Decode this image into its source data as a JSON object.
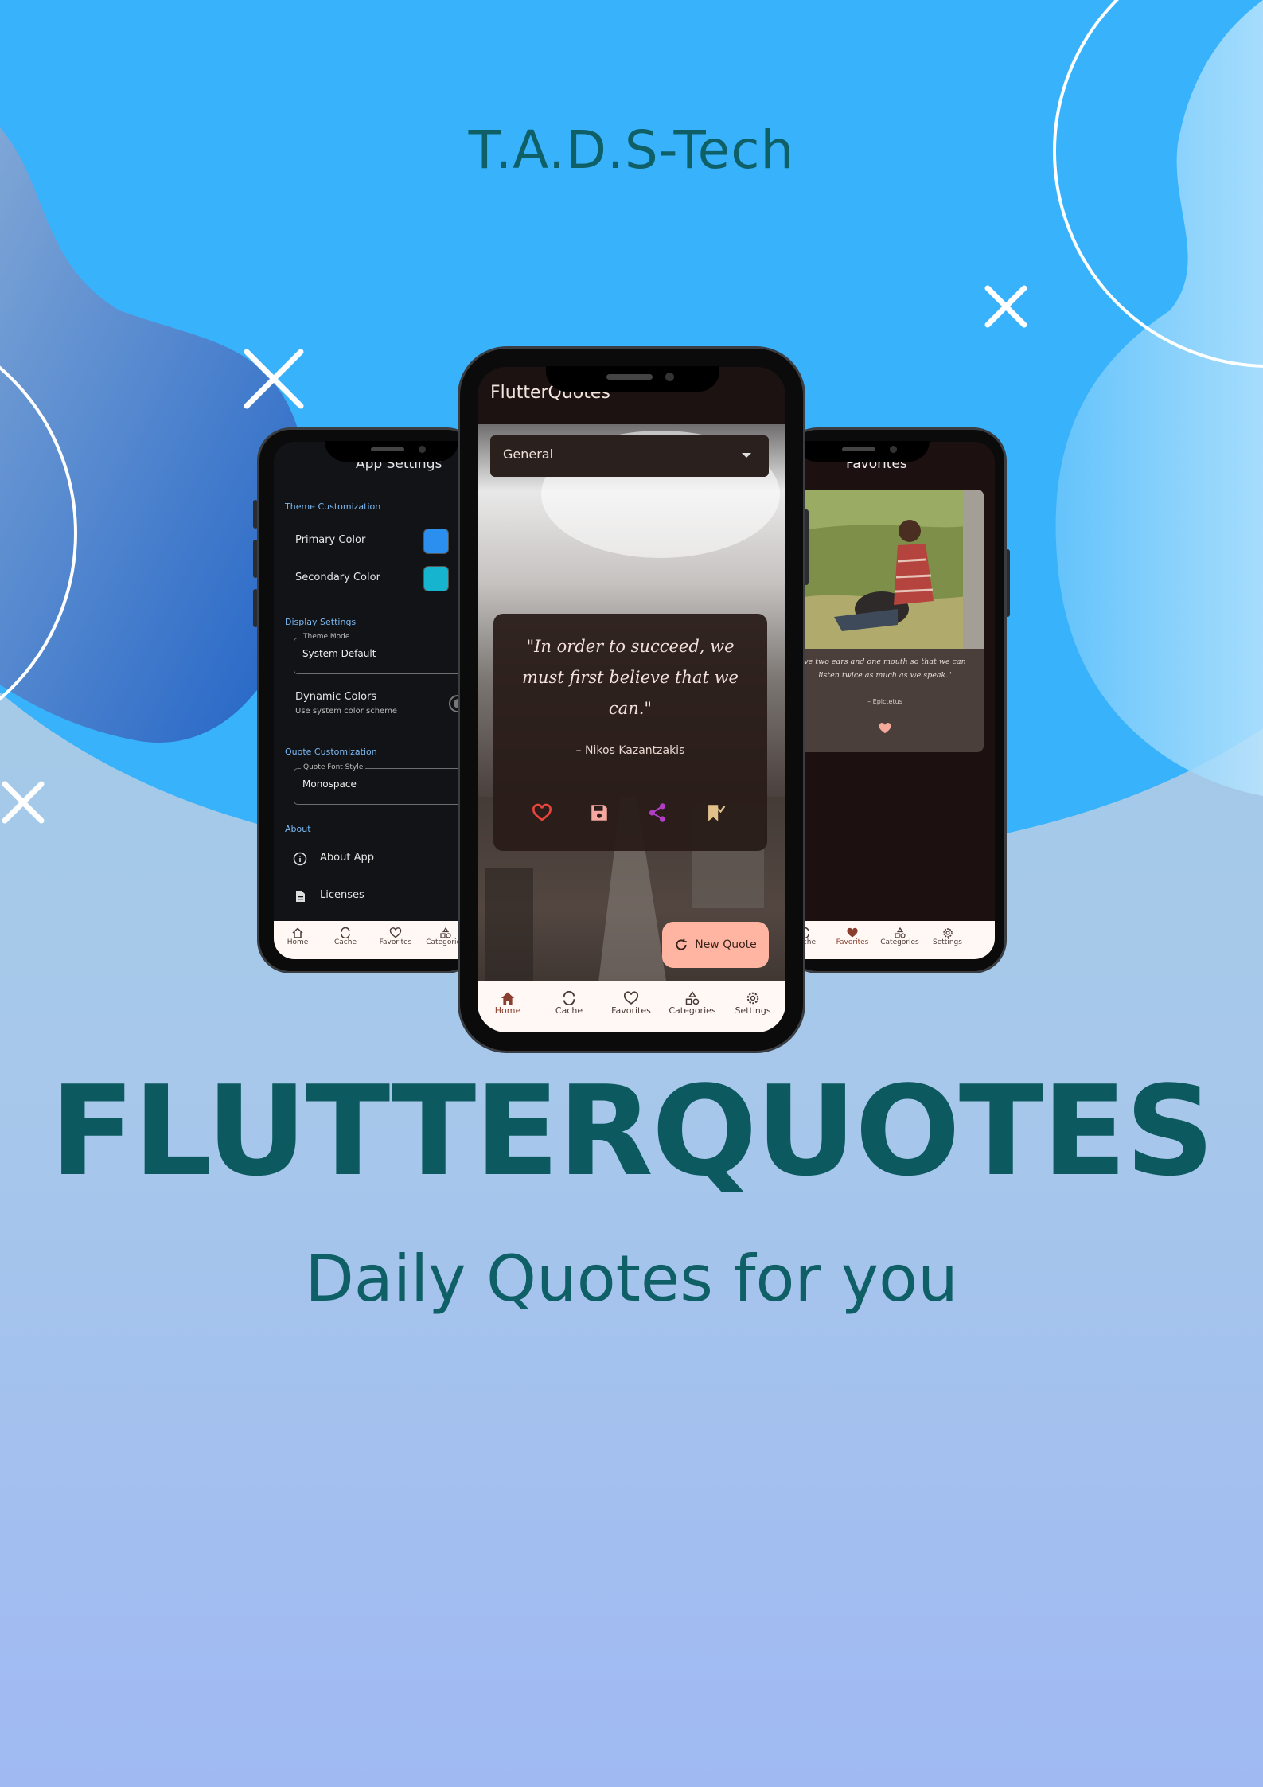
{
  "colors": {
    "sky": "#38b2fb",
    "bottom_gradient_top": "#9fcee3",
    "bottom_gradient_bottom": "#a2bdf2",
    "title": "#0c5a60",
    "accent_salmon": "#ffb5a2"
  },
  "brand": "T.A.D.S-Tech",
  "title": "FLUTTERQUOTES",
  "subtitle": "Daily Quotes for you",
  "settings_screen": {
    "title": "App Settings",
    "theme_section": "Theme Customization",
    "primary_color_label": "Primary Color",
    "primary_color": "#2b8ff0",
    "secondary_color_label": "Secondary Color",
    "secondary_color": "#16b4cf",
    "display_section": "Display Settings",
    "theme_mode_label": "Theme Mode",
    "theme_mode_value": "System Default",
    "dynamic_colors_label": "Dynamic Colors",
    "dynamic_colors_sub": "Use system color scheme",
    "quote_section": "Quote Customization",
    "font_style_label": "Quote Font Style",
    "font_style_value": "Monospace",
    "about_section": "About",
    "about_app": "About App",
    "licenses": "Licenses",
    "nav": [
      "Home",
      "Cache",
      "Favorites",
      "Categories"
    ]
  },
  "home_screen": {
    "app_title": "FlutterQuotes",
    "category": "General",
    "quote": "\"In order to succeed, we must first believe that we can.\"",
    "author": "– Nikos Kazantzakis",
    "action_icons": [
      "heart-icon",
      "save-icon",
      "share-icon",
      "bookmark-check-icon"
    ],
    "new_quote_label": "New Quote",
    "nav": [
      "Home",
      "Cache",
      "Favorites",
      "Categories",
      "Settings"
    ]
  },
  "favorites_screen": {
    "title": "Favorites",
    "quote": "We have two ears and one mouth so that we can listen twice as much as we speak.",
    "quote_visible_line1": "ve two ears and one mouth so that we can",
    "quote_visible_line2": "listen twice as much as we speak.\"",
    "author": "– Epictetus",
    "nav": [
      "Cache",
      "Favorites",
      "Categories",
      "Settings"
    ]
  }
}
